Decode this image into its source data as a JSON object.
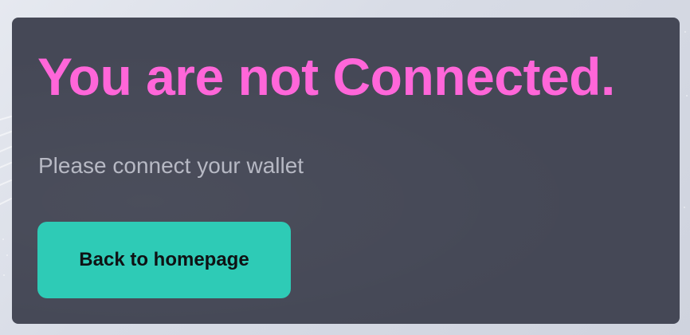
{
  "notice": {
    "title": "You are not Connected.",
    "message": "Please connect your wallet",
    "button_label": "Back to homepage"
  },
  "colors": {
    "title": "#ff66d9",
    "card_background": "#454856",
    "message": "#b7b9c4",
    "button_background": "#2ecbb6",
    "button_text": "#0f1214"
  }
}
